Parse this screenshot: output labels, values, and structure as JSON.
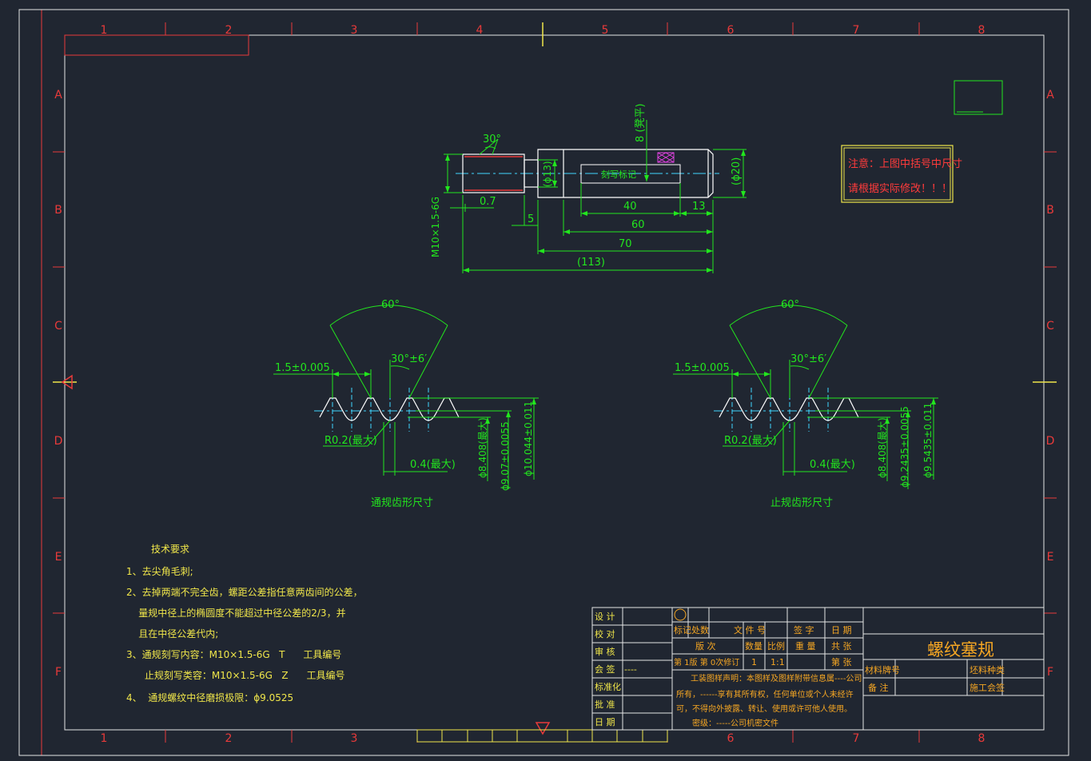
{
  "colors": {
    "background": "#202631",
    "frame": "#e5e5e5",
    "grid_text": "#e83a3a",
    "dimension": "#22e61e",
    "drawing_lines": "#ffffff",
    "centerline": "#3fd7ff",
    "text_yellow": "#f0e64a",
    "text_orange": "#f5a623",
    "text_red": "#ff3b3b",
    "marker_magenta": "#e544e5"
  },
  "grid": {
    "columns": [
      "1",
      "2",
      "3",
      "4",
      "5",
      "6",
      "7",
      "8"
    ],
    "rows": [
      "A",
      "B",
      "C",
      "D",
      "E",
      "F"
    ]
  },
  "main_view": {
    "angle_30": "30°",
    "mark_8": "8 (凳平)",
    "thread_label": "M10×1.5-6G",
    "d_0_7": "0.7",
    "d_5": "5",
    "d_phi13": "(ϕ13)",
    "engrave_label": "刻写标记",
    "d_40": "40",
    "d_13": "13",
    "d_60": "60",
    "d_70": "70",
    "d_113": "(113)",
    "d_phi20": "(ϕ20)"
  },
  "note_box": {
    "line1": "注意：上图中括号中尺寸",
    "line2": "请根据实际修改！！！"
  },
  "go_profile": {
    "angle_60": "60°",
    "angle_30": "30°±6′",
    "pitch": "1.5±0.005",
    "radius": "R0.2(最大)",
    "flat": "0.4(最大)",
    "d1": "ϕ8.408(最大)",
    "d2": "ϕ9.07±0.0055",
    "d3": "ϕ10.044±0.011",
    "caption": "通规齿形尺寸"
  },
  "nogo_profile": {
    "angle_60": "60°",
    "angle_30": "30°±6′",
    "pitch": "1.5±0.005",
    "radius": "R0.2(最大)",
    "flat": "0.4(最大)",
    "d1": "ϕ8.408(最大)",
    "d2": "ϕ9.2435±0.0055",
    "d3": "ϕ9.5435±0.011",
    "caption": "止规齿形尺寸"
  },
  "tech": {
    "title": "技术要求",
    "lines": [
      "1、去尖角毛刺;",
      "2、去掉两端不完全齿，螺距公差指任意两齿间的公差，",
      "    量规中径上的椭圆度不能超过中径公差的2/3，并",
      "    且在中径公差代内;",
      "3、通规刻写内容：M10×1.5-6G   T      工具编号",
      "      止规刻写类容：M10×1.5-6G   Z      工具编号",
      "4、  通规螺纹中径磨损极限：ϕ9.0525"
    ]
  },
  "title_block": {
    "left_labels": [
      "设  计",
      "校  对",
      "审  核",
      "会  签",
      "标准化",
      "批  准",
      "日  期"
    ],
    "sign_dash": "----",
    "header": [
      "标记",
      "处数",
      "文  件  号",
      "签  字",
      "日  期"
    ],
    "row2": [
      "版  次",
      "数量",
      "比例",
      "重  量",
      "共  张"
    ],
    "row3": [
      "第 1版 第 0次修订",
      "1",
      "1:1",
      "",
      "第  张"
    ],
    "statement": [
      "工装图样声明：本图样及图样附带信息属----公司",
      "所有，------享有其所有权，任何单位或个人未经许",
      "可，不得向外披露、转让、使用或许可他人使用。",
      "密级：-----公司机密文件"
    ],
    "part_name": "螺纹塞规",
    "material_label": "材料牌号",
    "material_kind": "坯料种类",
    "remark_label": "备  注",
    "process_sign": "施工会签"
  }
}
